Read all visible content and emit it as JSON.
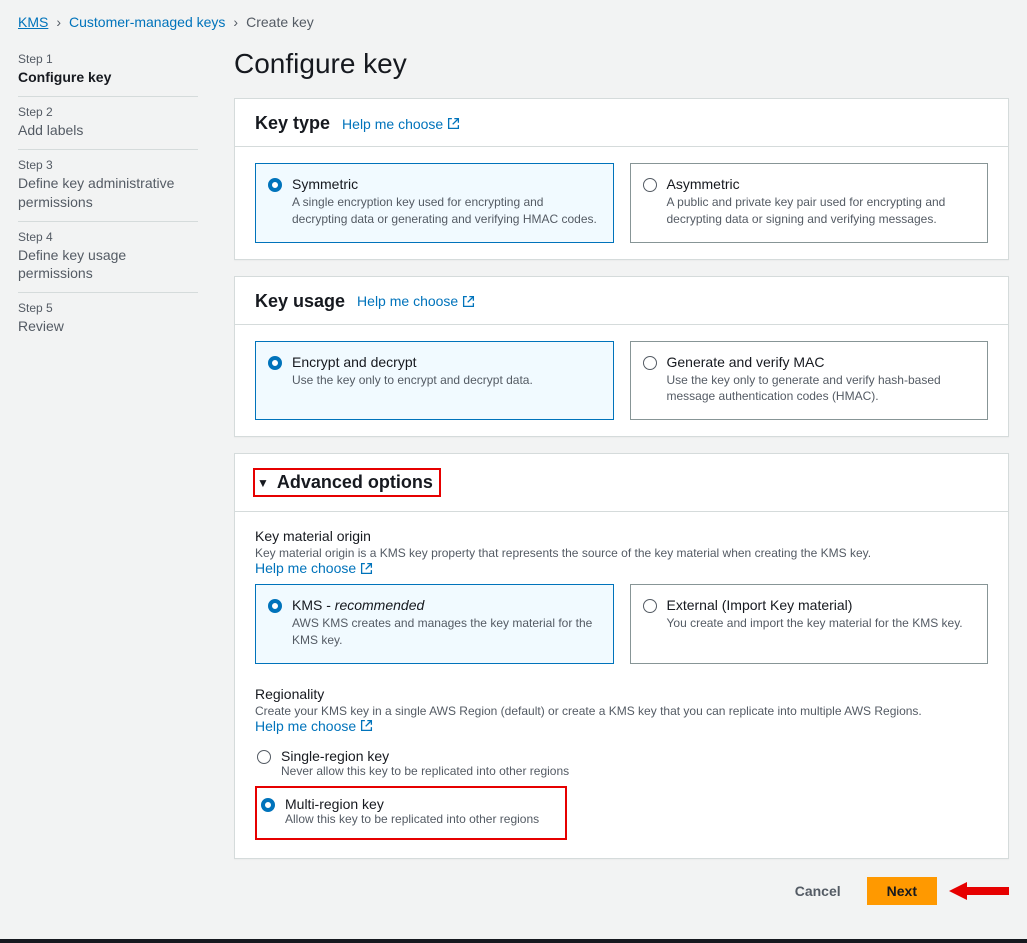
{
  "breadcrumb": {
    "root": "KMS",
    "parent": "Customer-managed keys",
    "current": "Create key"
  },
  "steps": [
    {
      "num": "Step 1",
      "title": "Configure key"
    },
    {
      "num": "Step 2",
      "title": "Add labels"
    },
    {
      "num": "Step 3",
      "title": "Define key administrative permissions"
    },
    {
      "num": "Step 4",
      "title": "Define key usage permissions"
    },
    {
      "num": "Step 5",
      "title": "Review"
    }
  ],
  "page_title": "Configure key",
  "help_label": "Help me choose",
  "key_type": {
    "heading": "Key type",
    "symmetric": {
      "title": "Symmetric",
      "desc": "A single encryption key used for encrypting and decrypting data or generating and verifying HMAC codes."
    },
    "asymmetric": {
      "title": "Asymmetric",
      "desc": "A public and private key pair used for encrypting and decrypting data or signing and verifying messages."
    }
  },
  "key_usage": {
    "heading": "Key usage",
    "encrypt": {
      "title": "Encrypt and decrypt",
      "desc": "Use the key only to encrypt and decrypt data."
    },
    "mac": {
      "title": "Generate and verify MAC",
      "desc": "Use the key only to generate and verify hash-based message authentication codes (HMAC)."
    }
  },
  "advanced": {
    "heading": "Advanced options",
    "origin": {
      "title": "Key material origin",
      "desc": "Key material origin is a KMS key property that represents the source of the key material when creating the KMS key.",
      "kms": {
        "title_prefix": "KMS - ",
        "title_suffix": "recommended",
        "desc": "AWS KMS creates and manages the key material for the KMS key."
      },
      "external": {
        "title": "External (Import Key material)",
        "desc": "You create and import the key material for the KMS key."
      }
    },
    "regionality": {
      "title": "Regionality",
      "desc": "Create your KMS key in a single AWS Region (default) or create a KMS key that you can replicate into multiple AWS Regions.",
      "single": {
        "title": "Single-region key",
        "desc": "Never allow this key to be replicated into other regions"
      },
      "multi": {
        "title": "Multi-region key",
        "desc": "Allow this key to be replicated into other regions"
      }
    }
  },
  "buttons": {
    "cancel": "Cancel",
    "next": "Next"
  }
}
